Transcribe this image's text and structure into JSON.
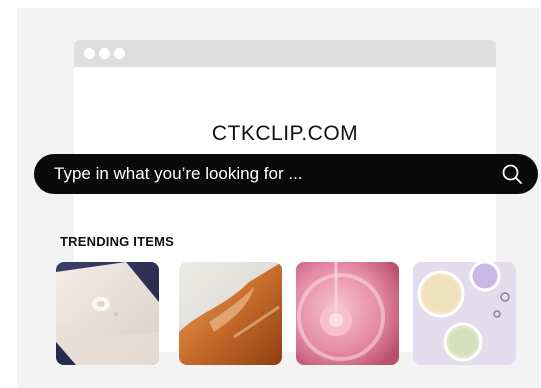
{
  "site": {
    "title": "CTKCLIP.COM"
  },
  "search": {
    "placeholder": "Type in what you’re looking for ...",
    "icon": "search-icon"
  },
  "trending": {
    "heading": "TRENDING ITEMS",
    "items": [
      {
        "icon": "cream-texture-image"
      },
      {
        "icon": "amber-liquid-image"
      },
      {
        "icon": "pink-gel-image"
      },
      {
        "icon": "serum-drops-image"
      }
    ]
  },
  "colors": {
    "search_bg": "#0a0a0a",
    "panel_bg": "#f3f3f3",
    "browser_bar": "#dedede"
  }
}
